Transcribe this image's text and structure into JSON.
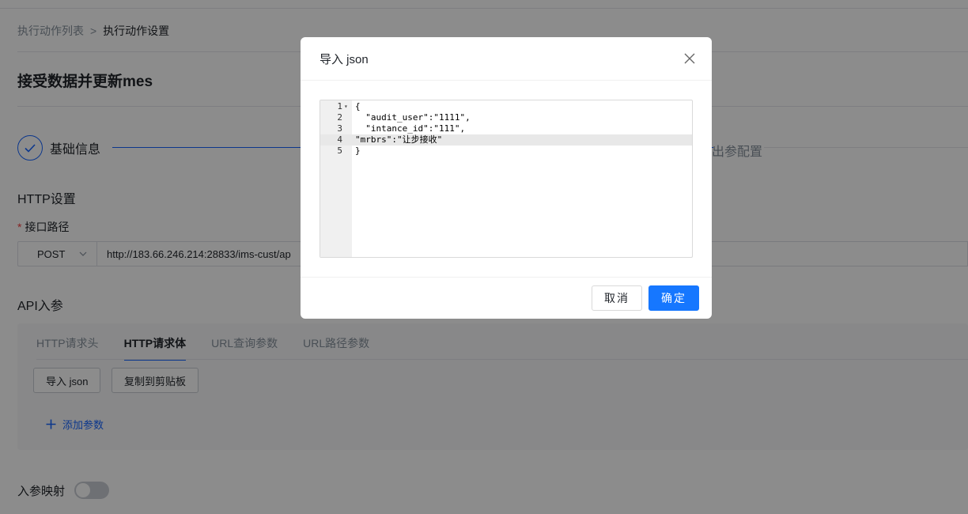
{
  "breadcrumb": {
    "parent": "执行动作列表",
    "separator": ">",
    "current": "执行动作设置"
  },
  "page_title": "接受数据并更新mes",
  "steps": {
    "step1_label": "基础信息",
    "step3_partial_label": "出参配置"
  },
  "http_settings": {
    "title": "HTTP设置",
    "path_label": "接口路径",
    "method": "POST",
    "url": "http://183.66.246.214:28833/ims-cust/ap"
  },
  "api_params": {
    "title": "API入参",
    "tabs": [
      "HTTP请求头",
      "HTTP请求体",
      "URL查询参数",
      "URL路径参数"
    ],
    "active_tab": "HTTP请求体",
    "import_button": "导入 json",
    "copy_button": "复制到剪贴板",
    "add_param": "添加参数"
  },
  "param_mapping": {
    "label": "入参映射",
    "enabled": false
  },
  "modal": {
    "title": "导入 json",
    "editor_lines": [
      {
        "num": "1",
        "text": "{"
      },
      {
        "num": "2",
        "text": "  \"audit_user\":\"1111\","
      },
      {
        "num": "3",
        "text": "  \"intance_id\":\"111\","
      },
      {
        "num": "4",
        "text": "\"mrbrs\":\"让步接收\""
      },
      {
        "num": "5",
        "text": "}"
      }
    ],
    "cancel_label": "取消",
    "ok_label": "确定"
  },
  "colors": {
    "primary": "#1677ff",
    "step_blue": "#1664ff",
    "mask": "rgba(0,0,0,0.45)"
  }
}
